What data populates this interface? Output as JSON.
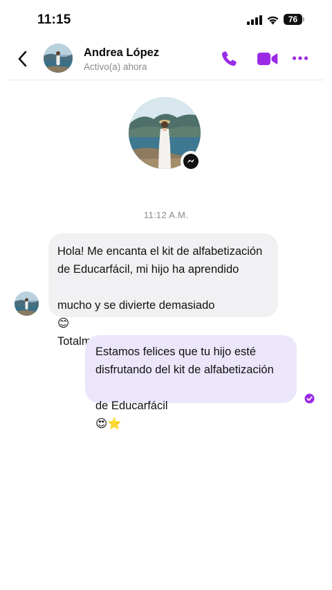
{
  "status_bar": {
    "time": "11:15",
    "battery": "76"
  },
  "header": {
    "contact_name": "Andrea López",
    "contact_status": "Activo(a) ahora"
  },
  "colors": {
    "accent": "#9b2ce6",
    "incoming_bubble": "#f1f1f3",
    "outgoing_bubble": "#ece6fb"
  },
  "icons": [
    "chevron-left-icon",
    "phone-icon",
    "video-camera-icon",
    "more-dots-icon",
    "messenger-icon",
    "read-check-icon"
  ],
  "conversation": {
    "timestamp": "11:12 A.M.",
    "messages": [
      {
        "direction": "incoming",
        "line1": "Hola! Me encanta el kit de alfabetización",
        "line2": "de Educarfácil, mi hijo ha aprendido",
        "line3": "mucho y se divierte demasiado",
        "line3_emoji": "😊",
        "line4": "Totalmente recomendado!"
      },
      {
        "direction": "outgoing",
        "line1": "Estamos felices que tu hijo esté",
        "line2": "disfrutando del kit de alfabetización",
        "line3": "de Educarfácil",
        "line3_emoji": "😍⭐"
      }
    ]
  }
}
